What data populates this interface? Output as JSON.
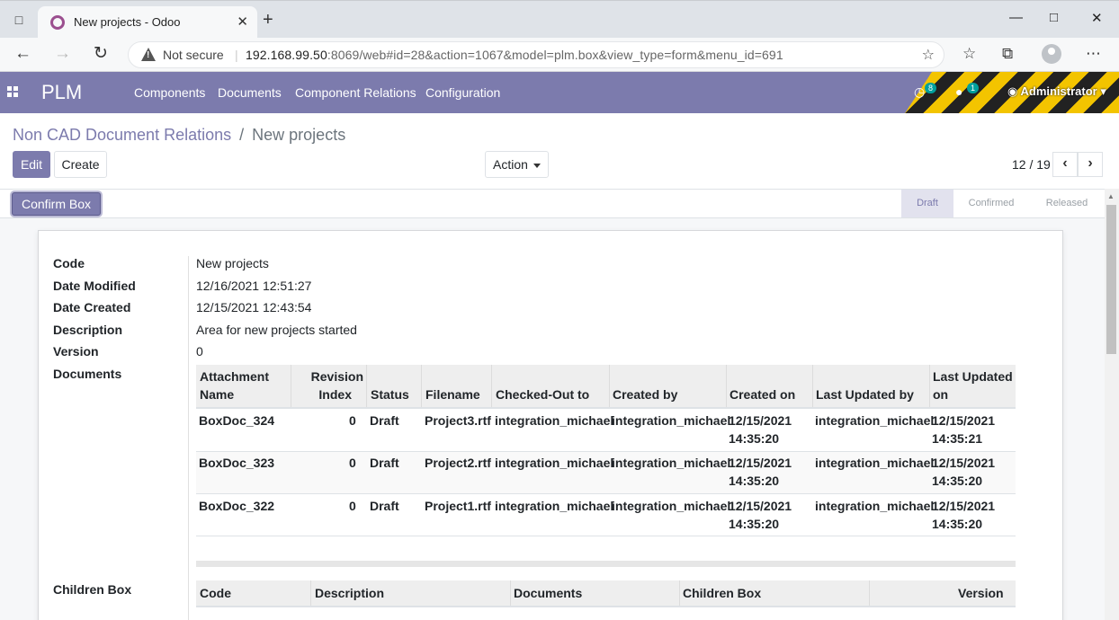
{
  "browser": {
    "tab_title": "New projects - Odoo",
    "not_secure": "Not secure",
    "url_host": "192.168.99.50",
    "url_rest": ":8069/web#id=28&action=1067&model=plm.box&view_type=form&menu_id=691"
  },
  "navbar": {
    "brand": "PLM",
    "menus": [
      "Components",
      "Documents",
      "Component Relations",
      "Configuration"
    ],
    "activity_count": "8",
    "message_count": "1",
    "user": "Administrator"
  },
  "breadcrumb": {
    "parent": "Non CAD Document Relations",
    "separator": "/",
    "current": "New projects"
  },
  "controls": {
    "edit": "Edit",
    "create": "Create",
    "action": "Action",
    "pager": "12 / 19"
  },
  "statusbar": {
    "confirm_button": "Confirm Box",
    "stages": [
      "Draft",
      "Confirmed",
      "Released"
    ],
    "active_stage": "Draft"
  },
  "form": {
    "code_label": "Code",
    "code": "New projects",
    "date_modified_label": "Date Modified",
    "date_modified": "12/16/2021 12:51:27",
    "date_created_label": "Date Created",
    "date_created": "12/15/2021 12:43:54",
    "description_label": "Description",
    "description": "Area for new projects started",
    "version_label": "Version",
    "version": "0",
    "documents_label": "Documents",
    "children_label": "Children Box"
  },
  "documents_table": {
    "headers": {
      "attachment_1": "Attachment",
      "attachment_2": "Name",
      "revision_1": "Revision",
      "revision_2": "Index",
      "status": "Status",
      "filename": "Filename",
      "checked_out": "Checked-Out to",
      "created_by": "Created by",
      "created_on": "Created on",
      "updated_by": "Last Updated by",
      "updated_on_1": "Last Updated",
      "updated_on_2": "on"
    },
    "rows": [
      {
        "name": "BoxDoc_324",
        "rev": "0",
        "status": "Draft",
        "file": "Project3.rtf",
        "checked": "integration_michael",
        "created_by": "integration_michael",
        "created_on_d": "12/15/2021",
        "created_on_t": "14:35:20",
        "updated_by": "integration_michael",
        "updated_on_d": "12/15/2021",
        "updated_on_t": "14:35:21"
      },
      {
        "name": "BoxDoc_323",
        "rev": "0",
        "status": "Draft",
        "file": "Project2.rtf",
        "checked": "integration_michael",
        "created_by": "integration_michael",
        "created_on_d": "12/15/2021",
        "created_on_t": "14:35:20",
        "updated_by": "integration_michael",
        "updated_on_d": "12/15/2021",
        "updated_on_t": "14:35:20"
      },
      {
        "name": "BoxDoc_322",
        "rev": "0",
        "status": "Draft",
        "file": "Project1.rtf",
        "checked": "integration_michael",
        "created_by": "integration_michael",
        "created_on_d": "12/15/2021",
        "created_on_t": "14:35:20",
        "updated_by": "integration_michael",
        "updated_on_d": "12/15/2021",
        "updated_on_t": "14:35:20"
      }
    ]
  },
  "children_table": {
    "headers": {
      "code": "Code",
      "description": "Description",
      "documents": "Documents",
      "children": "Children Box",
      "version": "Version"
    }
  },
  "colors": {
    "brand": "#7c7bad",
    "badge": "#00a09d",
    "stripe_yellow": "#f3c400"
  }
}
